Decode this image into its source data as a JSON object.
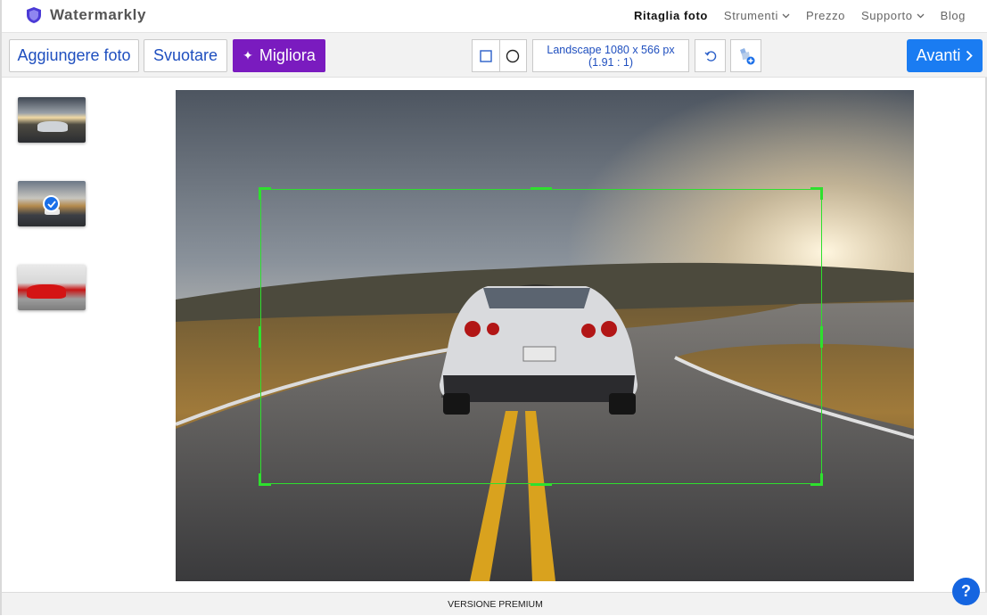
{
  "header": {
    "brand": "Watermarkly",
    "nav": [
      {
        "label": "Ritaglia foto",
        "active": true,
        "dropdown": false
      },
      {
        "label": "Strumenti",
        "active": false,
        "dropdown": true
      },
      {
        "label": "Prezzo",
        "active": false,
        "dropdown": false
      },
      {
        "label": "Supporto",
        "active": false,
        "dropdown": true
      },
      {
        "label": "Blog",
        "active": false,
        "dropdown": false
      }
    ]
  },
  "toolbar": {
    "add_label": "Aggiungere foto",
    "clear_label": "Svuotare",
    "improve_label": "Migliora",
    "ratio_line1": "Landscape 1080 x 566 px",
    "ratio_line2": "(1.91 : 1)",
    "next_label": "Avanti"
  },
  "thumbnails": [
    {
      "name": "car-sunset",
      "selected": false
    },
    {
      "name": "car-road",
      "selected": true
    },
    {
      "name": "red-car",
      "selected": false
    }
  ],
  "footer": {
    "label": "VERSIONE PREMIUM"
  },
  "help_label": "?",
  "colors": {
    "accent_blue": "#1a7cf2",
    "improve_purple": "#7a1bbf",
    "crop_green": "#2ee02e"
  },
  "icons": [
    "shield-logo-icon",
    "chevron-down-icon",
    "sparkle-icon",
    "square-shape-icon",
    "circle-shape-icon",
    "rotate-icon",
    "add-image-icon",
    "chevron-right-icon",
    "checkmark-icon",
    "help-icon"
  ]
}
